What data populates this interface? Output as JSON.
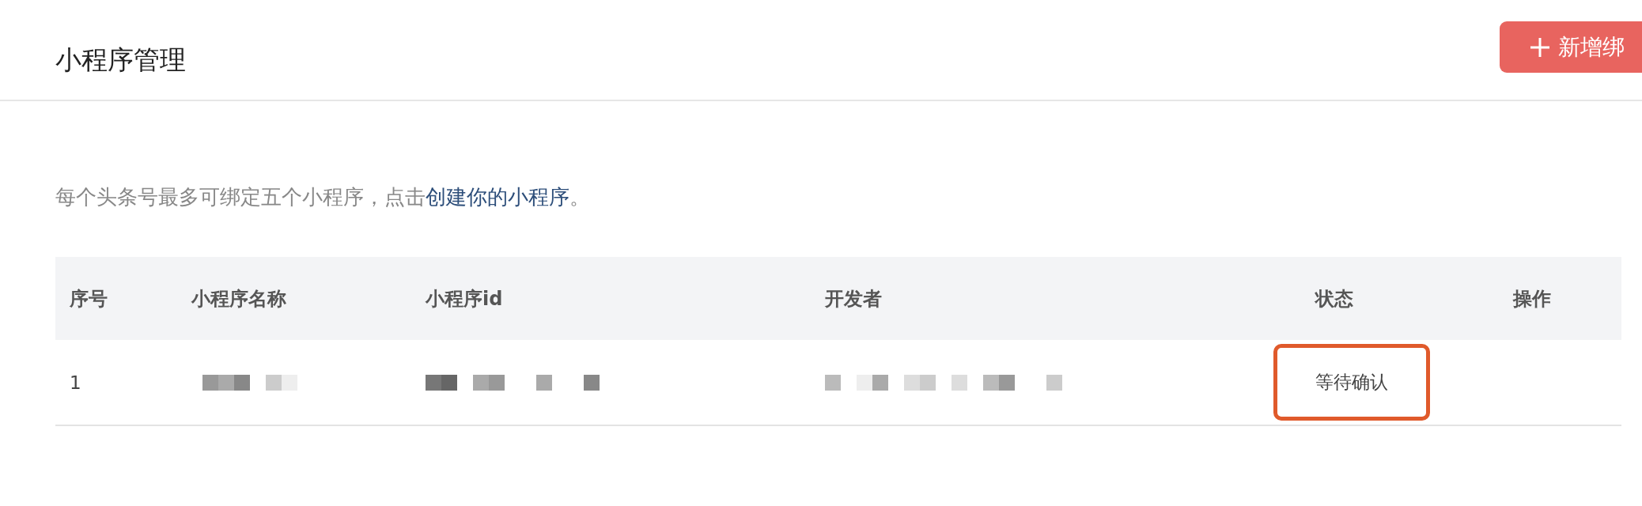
{
  "header": {
    "title": "小程序管理",
    "add_button": {
      "label": "新增绑"
    }
  },
  "notice": {
    "text_before": "每个头条号最多可绑定五个小程序，点击",
    "link": "创建你的小程序",
    "text_after": "。"
  },
  "table": {
    "columns": [
      "序号",
      "小程序名称",
      "小程序id",
      "开发者",
      "状态",
      "操作"
    ],
    "rows": [
      {
        "cells": [
          {
            "kind": "text",
            "text": "1"
          },
          {
            "kind": "redacted"
          },
          {
            "kind": "redacted"
          },
          {
            "kind": "redacted"
          },
          {
            "kind": "text",
            "text": "等待确认",
            "highlighted": true
          }
        ]
      }
    ]
  }
}
